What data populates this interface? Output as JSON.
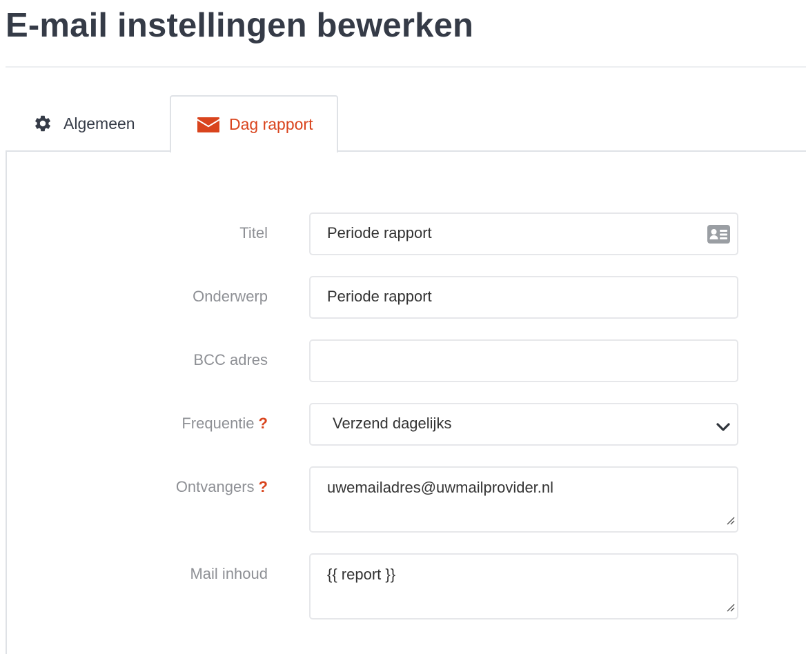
{
  "page": {
    "title": "E-mail instellingen bewerken"
  },
  "tabs": [
    {
      "label": "Algemeen",
      "icon": "gear-icon",
      "active": false
    },
    {
      "label": "Dag rapport",
      "icon": "envelope-icon",
      "active": true
    }
  ],
  "form": {
    "titel": {
      "label": "Titel",
      "value": "Periode rapport",
      "icon": "id-card-icon"
    },
    "onderwerp": {
      "label": "Onderwerp",
      "value": "Periode rapport"
    },
    "bcc": {
      "label": "BCC adres",
      "value": ""
    },
    "frequentie": {
      "label": "Frequentie",
      "help": "?",
      "value": "Verzend dagelijks"
    },
    "ontvangers": {
      "label": "Ontvangers",
      "help": "?",
      "value": "uwemailadres@uwmailprovider.nl"
    },
    "inhoud": {
      "label": "Mail inhoud",
      "value": "{{ report }}"
    }
  },
  "colors": {
    "accent": "#d9441d",
    "heading": "#353b47",
    "label": "#8e9095",
    "border": "#dfe2e6"
  }
}
